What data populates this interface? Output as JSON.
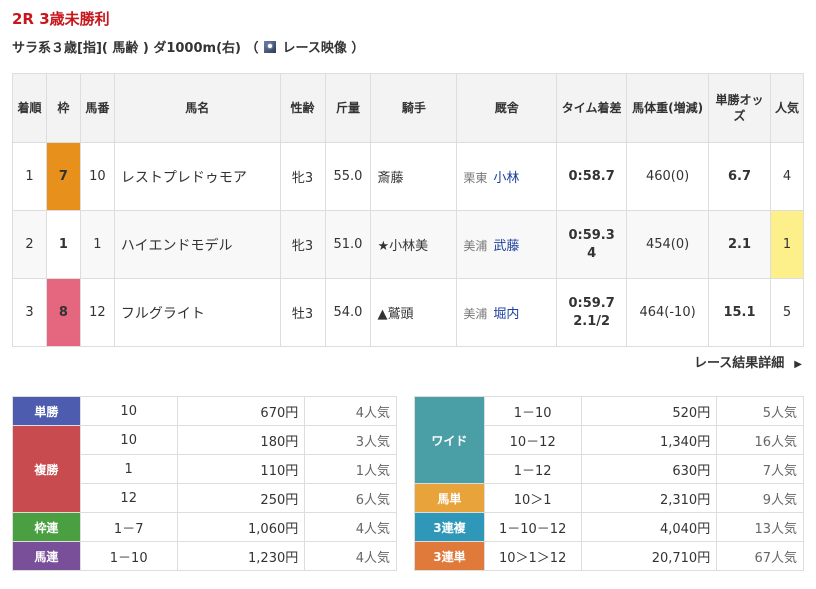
{
  "race": {
    "title": "2R 3歳未勝利",
    "conditions": "サラ系３歳[指]( 馬齢 ) ダ1000m(右) （",
    "video_label": "レース映像",
    "close_paren": " ）"
  },
  "headers": {
    "rank": "着順",
    "waku": "枠",
    "uma": "馬番",
    "name": "馬名",
    "sexage": "性齢",
    "weight": "斤量",
    "jockey": "騎手",
    "trainer": "厩舎",
    "time": "タイム着差",
    "bodyweight": "馬体重(増減)",
    "odds": "単勝オッズ",
    "pop": "人気"
  },
  "rows": [
    {
      "rank": "1",
      "waku": "7",
      "uma": "10",
      "name": "レストプレドゥモア",
      "sexage": "牝3",
      "weight": "55.0",
      "jockey": "斎藤",
      "tr_area": "栗東",
      "tr_name": "小林",
      "time": "0:58.7",
      "margin": "",
      "bw": "460(0)",
      "odds": "6.7",
      "pop": "4"
    },
    {
      "rank": "2",
      "waku": "1",
      "uma": "1",
      "name": "ハイエンドモデル",
      "sexage": "牝3",
      "weight": "51.0",
      "jockey": "★小林美",
      "tr_area": "美浦",
      "tr_name": "武藤",
      "time": "0:59.3",
      "margin": "4",
      "bw": "454(0)",
      "odds": "2.1",
      "pop": "1"
    },
    {
      "rank": "3",
      "waku": "8",
      "uma": "12",
      "name": "フルグライト",
      "sexage": "牡3",
      "weight": "54.0",
      "jockey": "▲鷲頭",
      "tr_area": "美浦",
      "tr_name": "堀内",
      "time": "0:59.7",
      "margin": "2.1/2",
      "bw": "464(-10)",
      "odds": "15.1",
      "pop": "5"
    }
  ],
  "detail_link": "レース結果詳細",
  "payout_left": {
    "tan": {
      "label": "単勝",
      "num": "10",
      "yen": "670円",
      "pop": "4人気"
    },
    "fuku": {
      "label": "複勝",
      "rows": [
        {
          "num": "10",
          "yen": "180円",
          "pop": "3人気"
        },
        {
          "num": "1",
          "yen": "110円",
          "pop": "1人気"
        },
        {
          "num": "12",
          "yen": "250円",
          "pop": "6人気"
        }
      ]
    },
    "waku": {
      "label": "枠連",
      "num": "1－7",
      "yen": "1,060円",
      "pop": "4人気"
    },
    "uma": {
      "label": "馬連",
      "num": "1－10",
      "yen": "1,230円",
      "pop": "4人気"
    }
  },
  "payout_right": {
    "wide": {
      "label": "ワイド",
      "rows": [
        {
          "num": "1－10",
          "yen": "520円",
          "pop": "5人気"
        },
        {
          "num": "10－12",
          "yen": "1,340円",
          "pop": "16人気"
        },
        {
          "num": "1－12",
          "yen": "630円",
          "pop": "7人気"
        }
      ]
    },
    "umatan": {
      "label": "馬単",
      "num": "10＞1",
      "yen": "2,310円",
      "pop": "9人気"
    },
    "sanfuku": {
      "label": "3連複",
      "num": "1－10－12",
      "yen": "4,040円",
      "pop": "13人気"
    },
    "santan": {
      "label": "3連単",
      "num": "10＞1＞12",
      "yen": "20,710円",
      "pop": "67人気"
    }
  },
  "colors": {
    "title": "#c8161d",
    "link": "#1a3f9e",
    "waku7": "#e8901c",
    "waku8": "#e5677f",
    "pop1_highlight": "#fdf08a"
  }
}
